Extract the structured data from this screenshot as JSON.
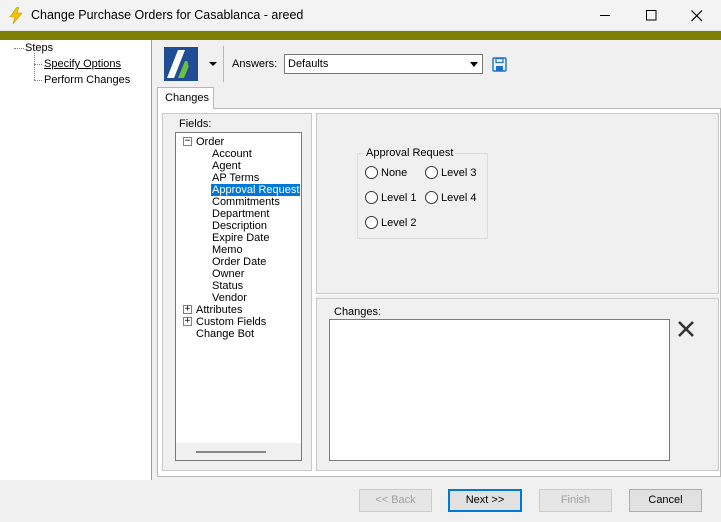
{
  "window": {
    "title": "Change Purchase Orders for Casablanca - areed",
    "controls": {
      "minimize": "minimize-icon",
      "maximize": "maximize-icon",
      "close": "close-icon"
    }
  },
  "steps": {
    "root": "Steps",
    "items": [
      {
        "label": "Specify Options",
        "current": true
      },
      {
        "label": "Perform Changes",
        "current": false
      }
    ]
  },
  "toolbar": {
    "answers_label": "Answers:",
    "answers_value": "Defaults"
  },
  "tabs": [
    {
      "label": "Changes",
      "active": true
    }
  ],
  "fields": {
    "label": "Fields:",
    "tree": {
      "order": {
        "label": "Order",
        "expanded": true,
        "children": [
          "Account",
          "Agent",
          "AP Terms",
          "Approval Request",
          "Commitments",
          "Department",
          "Description",
          "Expire Date",
          "Memo",
          "Order Date",
          "Owner",
          "Status",
          "Vendor"
        ],
        "selected_index": 3
      },
      "attributes": {
        "label": "Attributes",
        "expanded": false
      },
      "custom_fields": {
        "label": "Custom Fields",
        "expanded": false
      },
      "change_bot": {
        "label": "Change Bot"
      }
    }
  },
  "approval_request": {
    "title": "Approval Request",
    "options": [
      "None",
      "Level 3",
      "Level 1",
      "Level 4",
      "Level 2"
    ]
  },
  "changes": {
    "label": "Changes:",
    "content": ""
  },
  "footer": {
    "back": "<< Back",
    "next": "Next >>",
    "finish": "Finish",
    "cancel": "Cancel"
  },
  "colors": {
    "accent_bar": "#7f7f00",
    "selection": "#0078d7",
    "save_icon": "#1a73c9"
  }
}
